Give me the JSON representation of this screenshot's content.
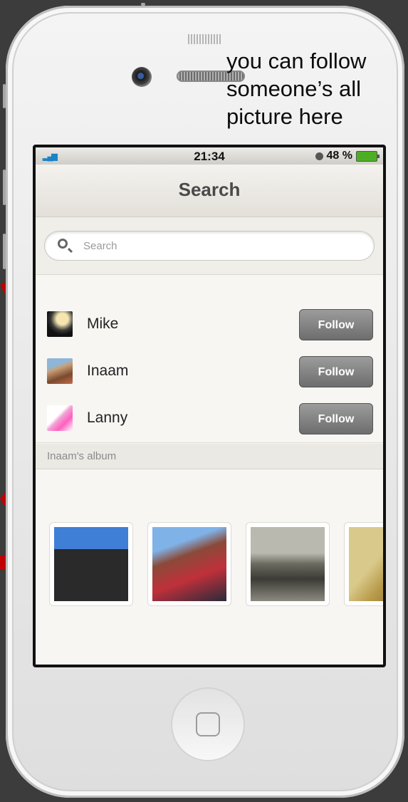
{
  "callout": {
    "text": "you can follow someone’s all picture here"
  },
  "status": {
    "time": "21:34",
    "battery": "48 %"
  },
  "nav": {
    "title": "Search"
  },
  "search": {
    "placeholder": "Search"
  },
  "users": [
    {
      "name": "Mike",
      "button": "Follow"
    },
    {
      "name": "Inaam",
      "button": "Follow"
    },
    {
      "name": "Lanny",
      "button": "Follow"
    }
  ],
  "album": {
    "label": "Inaam's album"
  },
  "colors": {
    "arrow": "#c00000",
    "follow_button": "#7a7a7a",
    "battery": "#4caf23"
  },
  "icons": [
    "signal-bars-icon",
    "clock-icon",
    "battery-icon",
    "search-icon",
    "home-button-icon"
  ]
}
